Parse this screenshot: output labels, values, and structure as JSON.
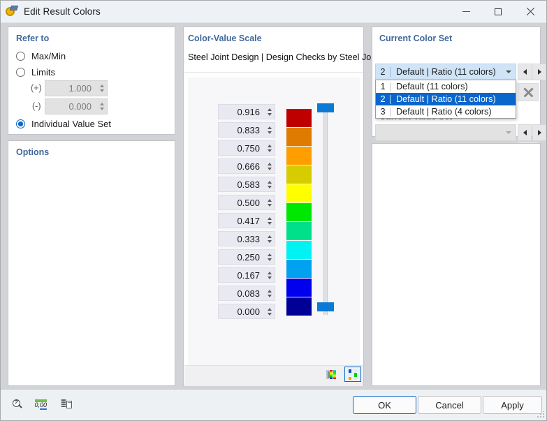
{
  "window": {
    "title": "Edit Result Colors",
    "icon": "result-colors-icon",
    "minimize_label": "Minimize",
    "maximize_label": "Maximize",
    "close_label": "Close"
  },
  "refer_to": {
    "title": "Refer to",
    "options": [
      {
        "label": "Max/Min",
        "selected": false
      },
      {
        "label": "Limits",
        "selected": false
      },
      {
        "label": "Individual Value Set",
        "selected": true
      }
    ],
    "limits": {
      "plus_label": "(+)",
      "plus_value": "1.000",
      "minus_label": "(-)",
      "minus_value": "0.000",
      "enabled": false
    }
  },
  "options_panel": {
    "title": "Options"
  },
  "scale": {
    "title": "Color-Value Scale",
    "caption": "Steel Joint Design | Design Checks by Steel Joints",
    "rows": [
      {
        "value": "0.916",
        "color": "#c00000"
      },
      {
        "value": "0.833",
        "color": "#dd7c00"
      },
      {
        "value": "0.750",
        "color": "#ff9e00"
      },
      {
        "value": "0.666",
        "color": "#d6cc00"
      },
      {
        "value": "0.583",
        "color": "#ffff00"
      },
      {
        "value": "0.500",
        "color": "#00e800"
      },
      {
        "value": "0.417",
        "color": "#00e08b"
      },
      {
        "value": "0.333",
        "color": "#00f2f2"
      },
      {
        "value": "0.250",
        "color": "#00a2f0"
      },
      {
        "value": "0.167",
        "color": "#0000ee"
      },
      {
        "value": "0.083",
        "color": "#000096"
      },
      {
        "value": "0.000",
        "color": null
      }
    ],
    "slider": {
      "handle_color": "#0a7ad4",
      "top_handle_label": "upper-limit-handle",
      "bottom_handle_label": "lower-limit-handle"
    },
    "toolbar": [
      {
        "name": "smooth-scale-button",
        "selected": false
      },
      {
        "name": "stepped-scale-button",
        "selected": true
      }
    ]
  },
  "color_set": {
    "title": "Current Color Set",
    "selected": {
      "number": "2",
      "label": "Default | Ratio (11 colors)"
    },
    "dropdown_open": true,
    "items": [
      {
        "number": "1",
        "label": "Default (11 colors)",
        "selected": false
      },
      {
        "number": "2",
        "label": "Default | Ratio (11 colors)",
        "selected": true
      },
      {
        "number": "3",
        "label": "Default | Ratio (4 colors)",
        "selected": false
      }
    ],
    "prev_label": "Previous color set",
    "next_label": "Next color set",
    "delete_label": "Delete color set"
  },
  "value_set": {
    "title": "Current Value Set",
    "selected_label": "",
    "enabled": false,
    "prev_label": "Previous value set",
    "next_label": "Next value set",
    "delete_label": "Delete value set",
    "toolbar": [
      {
        "name": "new-value-set-button",
        "enabled": false
      },
      {
        "name": "copy-value-set-button",
        "enabled": false
      },
      {
        "name": "edit-value-set-button",
        "enabled": false
      }
    ]
  },
  "footer": {
    "icons": [
      {
        "name": "help-magnifier-icon",
        "label": "Info"
      },
      {
        "name": "number-format-icon",
        "label": "0,00"
      },
      {
        "name": "export-data-icon",
        "label": "Export"
      }
    ],
    "buttons": [
      {
        "name": "ok-button",
        "label": "OK",
        "default": true
      },
      {
        "name": "cancel-button",
        "label": "Cancel",
        "default": false
      },
      {
        "name": "apply-button",
        "label": "Apply",
        "default": false
      }
    ]
  },
  "colors": {
    "accent": "#0a68c9",
    "panel_title": "#41689c",
    "titlebar_bg": "#eef2f6",
    "dialog_bg": "#d2d3d7",
    "highlight": "#0b66cc"
  }
}
